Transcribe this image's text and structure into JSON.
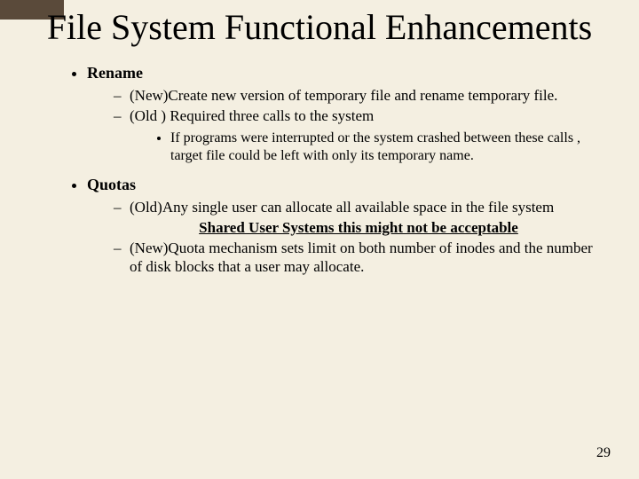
{
  "title": "File System Functional Enhancements",
  "bullets": {
    "rename": {
      "label": "Rename",
      "new": "(New)Create new version of temporary file and rename temporary file.",
      "old": "(Old ) Required three calls to the system",
      "detail": "If programs were interrupted or the system crashed between these calls , target file could be left with only its temporary name."
    },
    "quotas": {
      "label": "Quotas",
      "old": "(Old)Any single user can allocate all available space in the file system",
      "caution": "Shared User Systems this might not be acceptable",
      "new": "(New)Quota mechanism sets limit on both number of inodes and the number of disk blocks that a user may allocate."
    }
  },
  "page_number": "29"
}
